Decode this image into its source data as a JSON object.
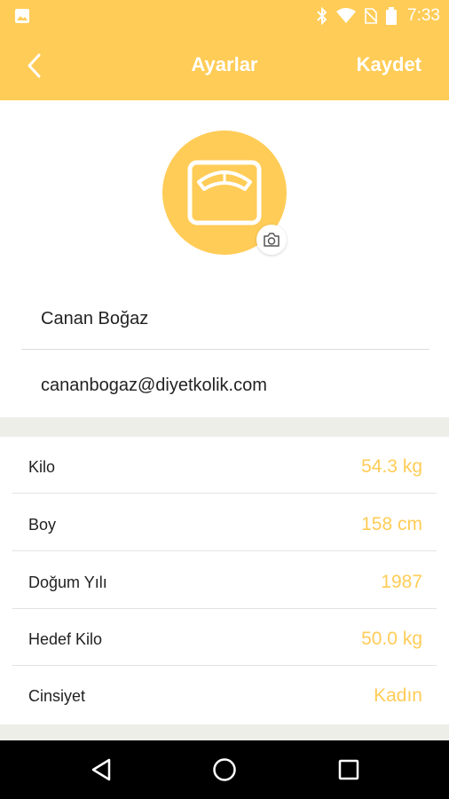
{
  "status_bar": {
    "time": "7:33",
    "icons": [
      "image-icon",
      "bluetooth-icon",
      "wifi-icon",
      "no-sim-icon",
      "battery-icon"
    ]
  },
  "app_bar": {
    "title": "Ayarlar",
    "back_icon": "chevron-left-icon",
    "save_label": "Kaydet"
  },
  "profile": {
    "avatar_icon": "scale-icon",
    "camera_icon": "camera-icon",
    "name": "Canan Boğaz",
    "email": "cananbogaz@diyetkolik.com"
  },
  "settings": [
    {
      "label": "Kilo",
      "value": "54.3 kg"
    },
    {
      "label": "Boy",
      "value": "158 cm"
    },
    {
      "label": "Doğum Yılı",
      "value": "1987"
    },
    {
      "label": "Hedef Kilo",
      "value": "50.0 kg"
    },
    {
      "label": "Cinsiyet",
      "value": "Kadın"
    }
  ],
  "colors": {
    "accent": "#FFCC57",
    "band": "#EEEEE9",
    "nav_bar": "#000000"
  }
}
